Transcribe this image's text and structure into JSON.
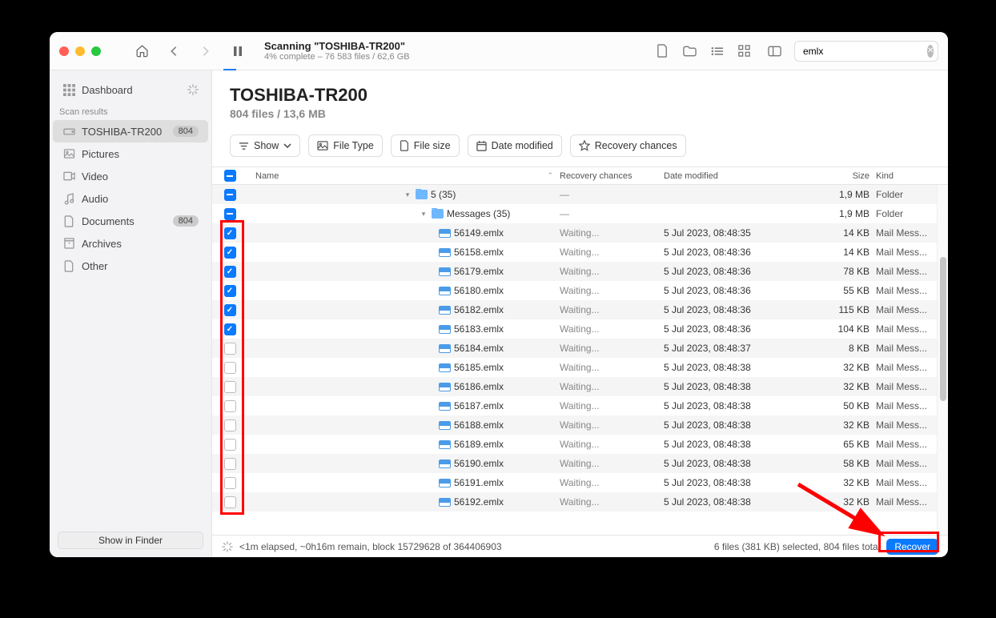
{
  "titlebar": {
    "scan_title": "Scanning \"TOSHIBA-TR200\"",
    "scan_subtitle": "4% complete – 76 583 files / 62,6 GB",
    "search_value": "emlx"
  },
  "sidebar": {
    "dashboard": "Dashboard",
    "section": "Scan results",
    "items": [
      {
        "label": "TOSHIBA-TR200",
        "badge": "804",
        "icon": "disk",
        "active": true
      },
      {
        "label": "Pictures",
        "icon": "picture"
      },
      {
        "label": "Video",
        "icon": "video"
      },
      {
        "label": "Audio",
        "icon": "audio"
      },
      {
        "label": "Documents",
        "badge": "804",
        "icon": "document"
      },
      {
        "label": "Archives",
        "icon": "archive"
      },
      {
        "label": "Other",
        "icon": "other"
      }
    ],
    "show_finder": "Show in Finder"
  },
  "header": {
    "title": "TOSHIBA-TR200",
    "subtitle": "804 files / 13,6 MB"
  },
  "filters": {
    "show": "Show",
    "filetype": "File Type",
    "filesize": "File size",
    "datemod": "Date modified",
    "recchances": "Recovery chances"
  },
  "columns": {
    "name": "Name",
    "recovery": "Recovery chances",
    "date": "Date modified",
    "size": "Size",
    "kind": "Kind"
  },
  "rows": [
    {
      "type": "folder",
      "check": "minus",
      "indent": 180,
      "name": "5 (35)",
      "recovery": "—",
      "date": "",
      "size": "1,9 MB",
      "kind": "Folder",
      "disclosure": "down"
    },
    {
      "type": "folder",
      "check": "minus",
      "indent": 200,
      "name": "Messages (35)",
      "recovery": "—",
      "date": "",
      "size": "1,9 MB",
      "kind": "Folder",
      "disclosure": "down"
    },
    {
      "type": "file",
      "check": "checked",
      "indent": 225,
      "name": "56149.emlx",
      "recovery": "Waiting...",
      "date": "5 Jul 2023, 08:48:35",
      "size": "14 KB",
      "kind": "Mail Mess..."
    },
    {
      "type": "file",
      "check": "checked",
      "indent": 225,
      "name": "56158.emlx",
      "recovery": "Waiting...",
      "date": "5 Jul 2023, 08:48:36",
      "size": "14 KB",
      "kind": "Mail Mess..."
    },
    {
      "type": "file",
      "check": "checked",
      "indent": 225,
      "name": "56179.emlx",
      "recovery": "Waiting...",
      "date": "5 Jul 2023, 08:48:36",
      "size": "78 KB",
      "kind": "Mail Mess..."
    },
    {
      "type": "file",
      "check": "checked",
      "indent": 225,
      "name": "56180.emlx",
      "recovery": "Waiting...",
      "date": "5 Jul 2023, 08:48:36",
      "size": "55 KB",
      "kind": "Mail Mess..."
    },
    {
      "type": "file",
      "check": "checked",
      "indent": 225,
      "name": "56182.emlx",
      "recovery": "Waiting...",
      "date": "5 Jul 2023, 08:48:36",
      "size": "115 KB",
      "kind": "Mail Mess..."
    },
    {
      "type": "file",
      "check": "checked",
      "indent": 225,
      "name": "56183.emlx",
      "recovery": "Waiting...",
      "date": "5 Jul 2023, 08:48:36",
      "size": "104 KB",
      "kind": "Mail Mess..."
    },
    {
      "type": "file",
      "check": "unchecked",
      "indent": 225,
      "name": "56184.emlx",
      "recovery": "Waiting...",
      "date": "5 Jul 2023, 08:48:37",
      "size": "8 KB",
      "kind": "Mail Mess..."
    },
    {
      "type": "file",
      "check": "unchecked",
      "indent": 225,
      "name": "56185.emlx",
      "recovery": "Waiting...",
      "date": "5 Jul 2023, 08:48:38",
      "size": "32 KB",
      "kind": "Mail Mess..."
    },
    {
      "type": "file",
      "check": "unchecked",
      "indent": 225,
      "name": "56186.emlx",
      "recovery": "Waiting...",
      "date": "5 Jul 2023, 08:48:38",
      "size": "32 KB",
      "kind": "Mail Mess..."
    },
    {
      "type": "file",
      "check": "unchecked",
      "indent": 225,
      "name": "56187.emlx",
      "recovery": "Waiting...",
      "date": "5 Jul 2023, 08:48:38",
      "size": "50 KB",
      "kind": "Mail Mess..."
    },
    {
      "type": "file",
      "check": "unchecked",
      "indent": 225,
      "name": "56188.emlx",
      "recovery": "Waiting...",
      "date": "5 Jul 2023, 08:48:38",
      "size": "32 KB",
      "kind": "Mail Mess..."
    },
    {
      "type": "file",
      "check": "unchecked",
      "indent": 225,
      "name": "56189.emlx",
      "recovery": "Waiting...",
      "date": "5 Jul 2023, 08:48:38",
      "size": "65 KB",
      "kind": "Mail Mess..."
    },
    {
      "type": "file",
      "check": "unchecked",
      "indent": 225,
      "name": "56190.emlx",
      "recovery": "Waiting...",
      "date": "5 Jul 2023, 08:48:38",
      "size": "58 KB",
      "kind": "Mail Mess..."
    },
    {
      "type": "file",
      "check": "unchecked",
      "indent": 225,
      "name": "56191.emlx",
      "recovery": "Waiting...",
      "date": "5 Jul 2023, 08:48:38",
      "size": "32 KB",
      "kind": "Mail Mess..."
    },
    {
      "type": "file",
      "check": "unchecked",
      "indent": 225,
      "name": "56192.emlx",
      "recovery": "Waiting...",
      "date": "5 Jul 2023, 08:48:38",
      "size": "32 KB",
      "kind": "Mail Mess..."
    }
  ],
  "footer": {
    "status": "<1m elapsed, ~0h16m remain, block 15729628 of 364406903",
    "selection": "6 files (381 KB) selected, 804 files total",
    "recover": "Recover"
  }
}
